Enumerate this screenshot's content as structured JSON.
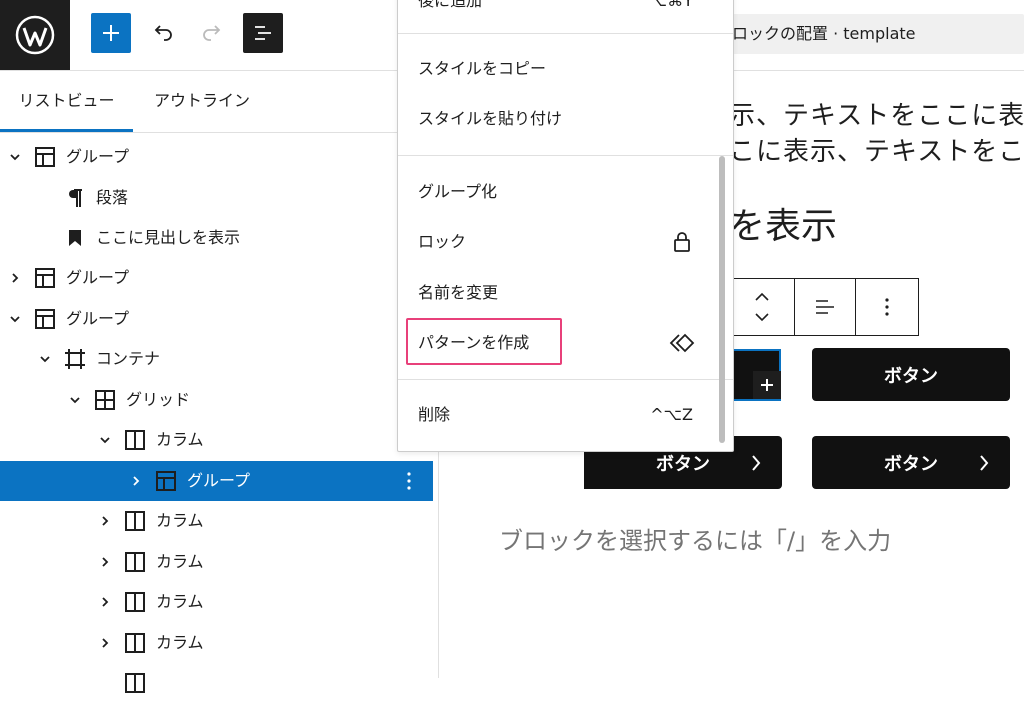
{
  "topbar": {
    "logo_icon": "wordpress-logo",
    "add_icon": "plus-icon",
    "undo_icon": "undo-icon",
    "redo_icon": "redo-icon",
    "list_view_icon": "list-view-icon",
    "doc_title": "ロックの配置 · template"
  },
  "sidebar": {
    "tabs": [
      "リストビュー",
      "アウトライン"
    ],
    "active_tab": "リストビュー",
    "tree": [
      {
        "label": "グループ",
        "icon": "group-icon",
        "expanded": true
      },
      {
        "label": "段落",
        "icon": "paragraph-icon"
      },
      {
        "label": "ここに見出しを表示",
        "icon": "heading-bookmark-icon"
      },
      {
        "label": "グループ",
        "icon": "group-icon",
        "expanded": false
      },
      {
        "label": "グループ",
        "icon": "group-icon",
        "expanded": true
      },
      {
        "label": "コンテナ",
        "icon": "container-icon",
        "expanded": true
      },
      {
        "label": "グリッド",
        "icon": "grid-icon",
        "expanded": true
      },
      {
        "label": "カラム",
        "icon": "column-icon",
        "expanded": true
      },
      {
        "label": "グループ",
        "icon": "group-icon",
        "expanded": false,
        "selected": true
      },
      {
        "label": "カラム",
        "icon": "column-icon",
        "expanded": false
      },
      {
        "label": "カラム",
        "icon": "column-icon",
        "expanded": false
      },
      {
        "label": "カラム",
        "icon": "column-icon",
        "expanded": false
      },
      {
        "label": "カラム",
        "icon": "column-icon",
        "expanded": false
      }
    ]
  },
  "canvas": {
    "text_line1": "示、テキストをここに表示",
    "text_line2": "こに表示、テキストをここ",
    "heading": "を表示",
    "buttons": [
      "ボタン",
      "ボタン",
      "ボタン"
    ],
    "placeholder": "ブロックを選択するには「/」を入力"
  },
  "menu": {
    "partial_top_item": "後に追加",
    "partial_top_shortcut": "⌥⌘Y",
    "items": [
      {
        "label": "スタイルをコピー"
      },
      {
        "label": "スタイルを貼り付け"
      },
      {
        "label": "グループ化"
      },
      {
        "label": "ロック",
        "icon": "lock-icon"
      },
      {
        "label": "名前を変更"
      },
      {
        "label": "パターンを作成",
        "icon": "pattern-symbol-icon",
        "highlighted": true
      },
      {
        "label": "削除",
        "shortcut": "^⌥Z"
      }
    ]
  },
  "colors": {
    "accent": "#0b73c2",
    "dark": "#1e1e1e",
    "highlight": "#e8407a",
    "button_bg": "#111111"
  }
}
